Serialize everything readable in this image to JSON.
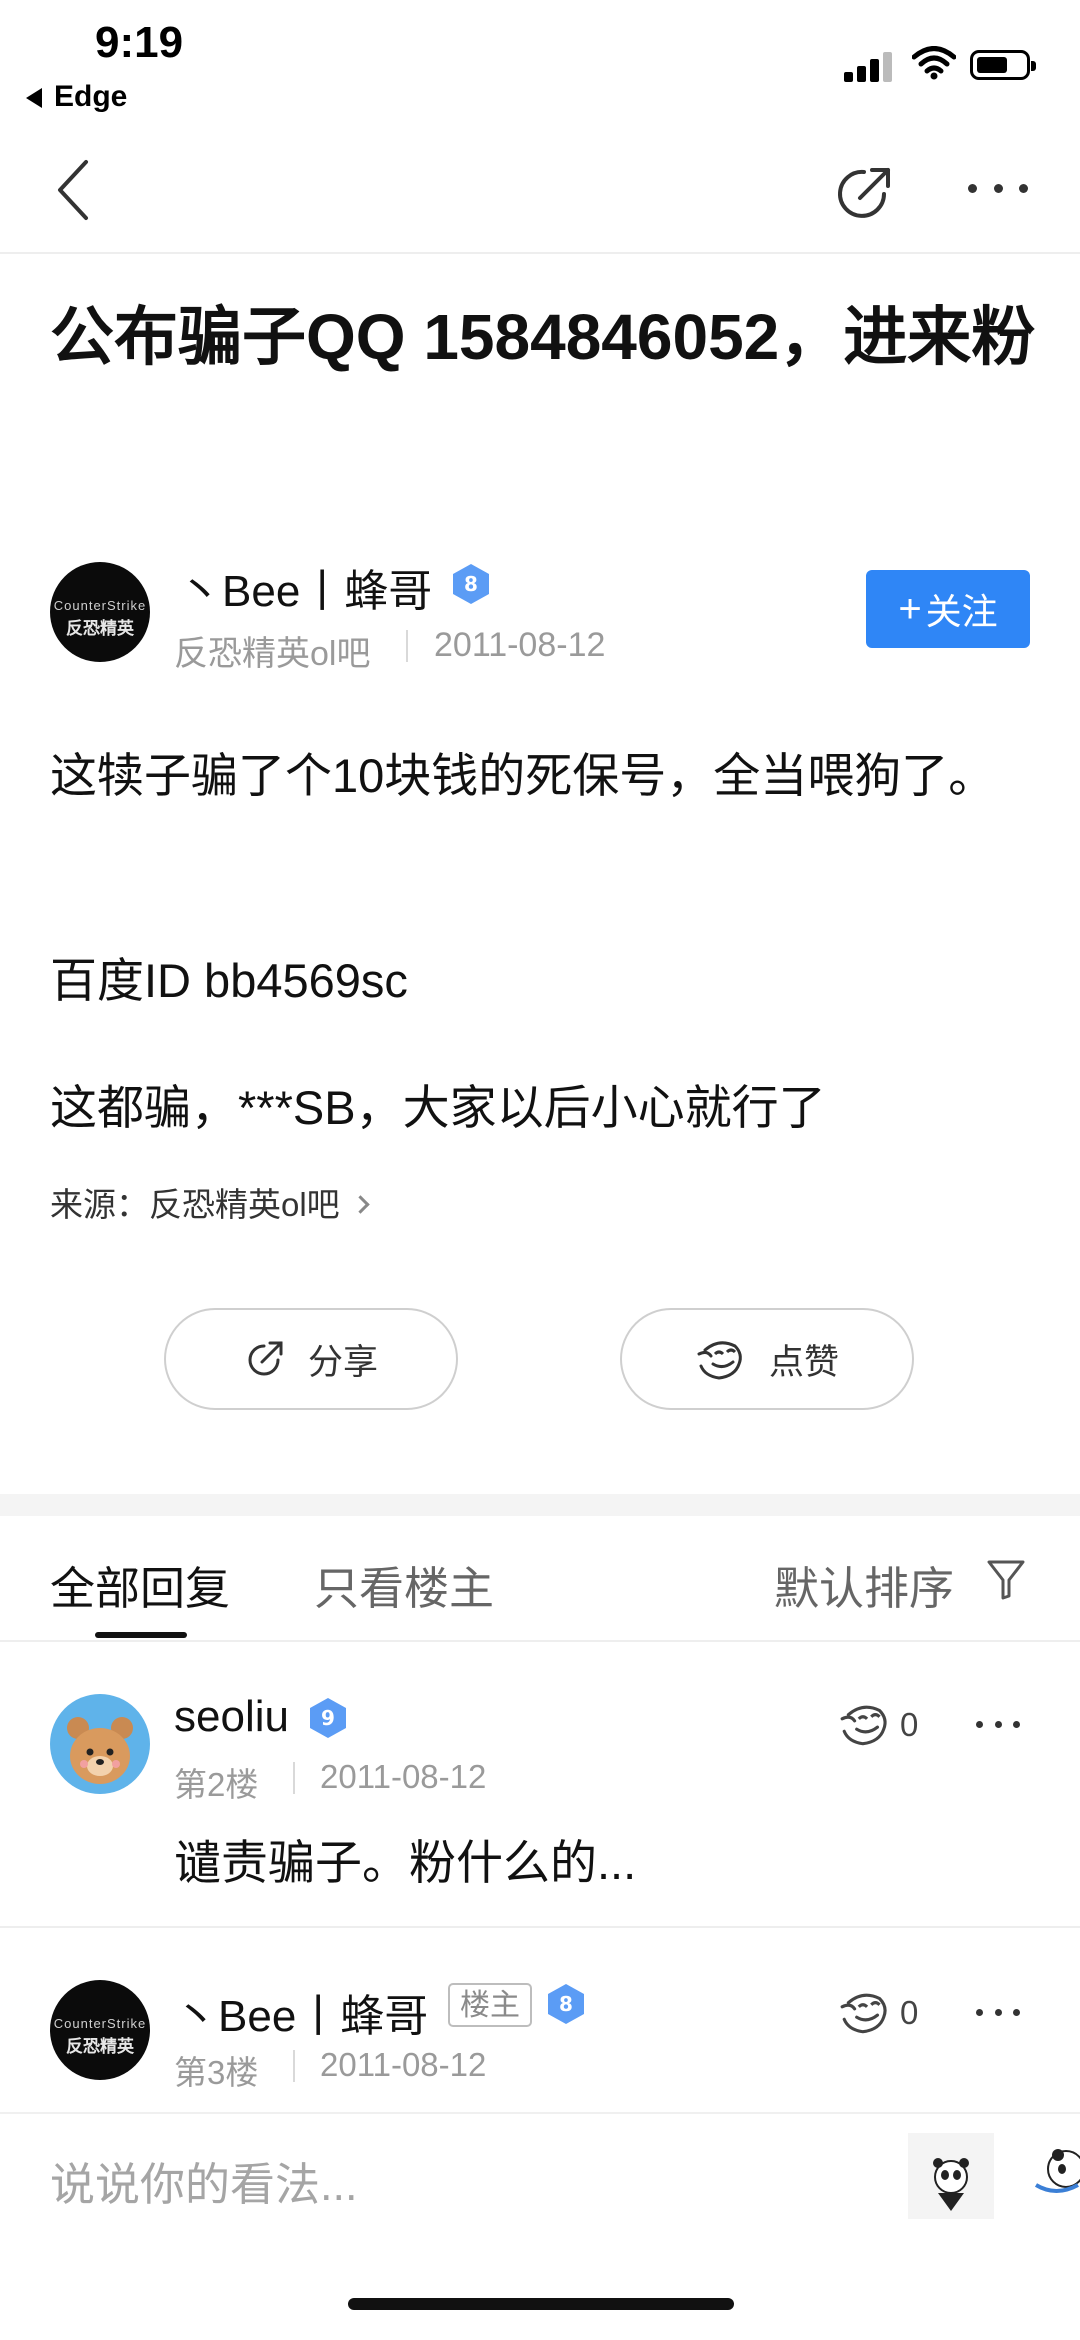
{
  "status_bar": {
    "time": "9:19",
    "back_app": "Edge"
  },
  "nav": {
    "back_icon": "chevron-left-icon",
    "share_icon": "share-icon",
    "more_icon": "more-icon"
  },
  "post": {
    "title": "公布骗子QQ 1584846052，进来粉",
    "author": {
      "name": "丶Bee丨蜂哥",
      "level": "8",
      "avatar_line1": "CounterStrike",
      "avatar_line2": "反恐精英"
    },
    "forum": "反恐精英ol吧",
    "date": "2011-08-12",
    "follow_label": "关注",
    "paragraphs": [
      "这犊子骗了个10块钱的死保号，全当喂狗了。",
      "百度ID bb4569sc",
      "这都骗，***SB，大家以后小心就行了"
    ],
    "source_prefix": "来源：",
    "source_forum": "反恐精英ol吧",
    "share_label": "分享",
    "like_label": "点赞"
  },
  "tabs": {
    "all": "全部回复",
    "host_only": "只看楼主",
    "sort": "默认排序"
  },
  "replies": [
    {
      "name": "seoliu",
      "level": "9",
      "floor": "第2楼",
      "date": "2011-08-12",
      "text": "谴责骗子。粉什么的...",
      "likes": "0"
    },
    {
      "name": "丶Bee丨蜂哥",
      "host_tag": "楼主",
      "level": "8",
      "floor": "第3楼",
      "date": "2011-08-12",
      "likes": "0"
    }
  ],
  "comment_box": {
    "placeholder": "说说你的看法..."
  },
  "colors": {
    "accent": "#2f86f6",
    "badge": "#5b9cf5"
  }
}
